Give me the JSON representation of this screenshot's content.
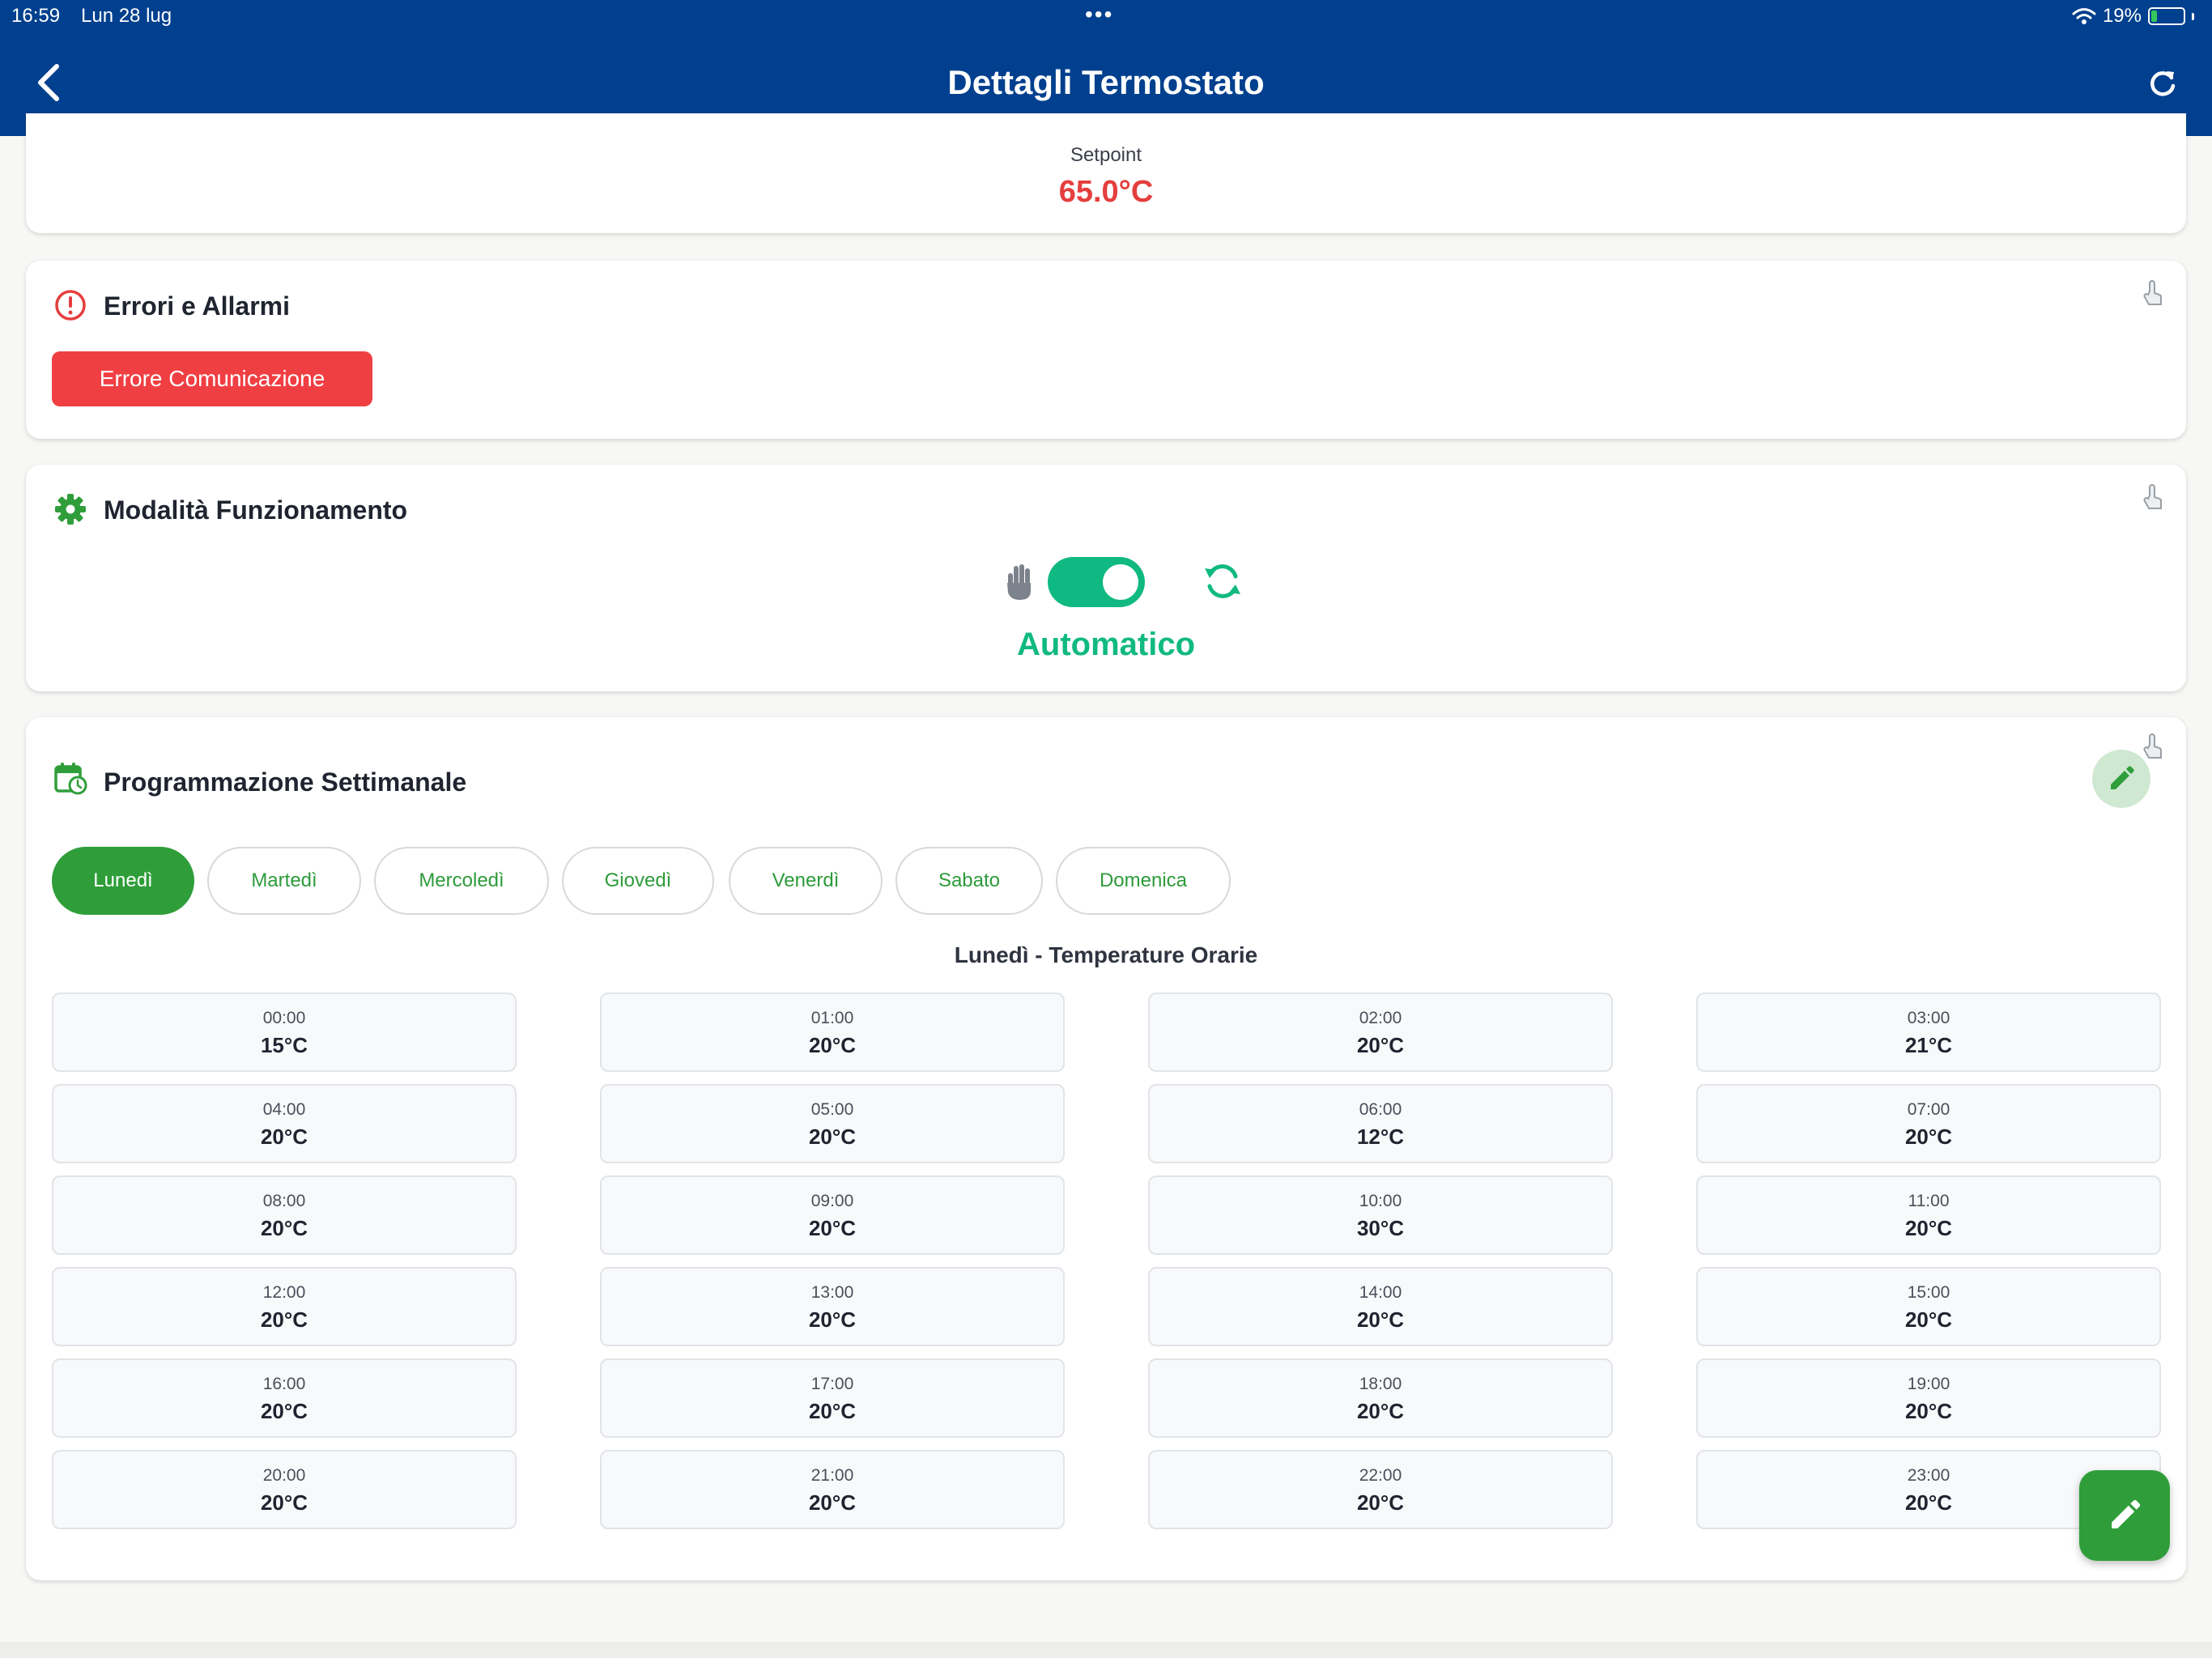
{
  "status_bar": {
    "time": "16:59",
    "date": "Lun 28 lug",
    "dots": "•••",
    "battery_percent": "19%",
    "battery_level": 0.19,
    "icons": [
      "wifi-icon",
      "battery-charging-icon"
    ]
  },
  "header": {
    "title": "Dettagli Termostato",
    "background_color": "#00408e",
    "icons": [
      "back-chevron-icon",
      "refresh-icon"
    ]
  },
  "setpoint": {
    "label": "Setpoint",
    "value": "65.0°C",
    "value_color": "#e53e3e"
  },
  "errors": {
    "title": "Errori e Allarmi",
    "icon": "alert-circle-icon",
    "chips": [
      "Errore Comunicazione"
    ],
    "chip_color": "#f03f43"
  },
  "mode": {
    "title": "Modalità Funzionamento",
    "icon": "gear-icon",
    "toggle_on": true,
    "label": "Automatico",
    "accent_color": "#10b981",
    "icons": [
      "hand-icon",
      "sync-icon"
    ]
  },
  "schedule": {
    "title": "Programmazione Settimanale",
    "icon": "calendar-clock-icon",
    "days": [
      "Lunedì",
      "Martedì",
      "Mercoledì",
      "Giovedì",
      "Venerdì",
      "Sabato",
      "Domenica"
    ],
    "active_day": "Lunedì",
    "hours_title": "Lunedì - Temperature Orarie",
    "accent_color": "#2f9e3a",
    "hours": [
      {
        "time": "00:00",
        "temp": "15°C"
      },
      {
        "time": "01:00",
        "temp": "20°C"
      },
      {
        "time": "02:00",
        "temp": "20°C"
      },
      {
        "time": "03:00",
        "temp": "21°C"
      },
      {
        "time": "04:00",
        "temp": "20°C"
      },
      {
        "time": "05:00",
        "temp": "20°C"
      },
      {
        "time": "06:00",
        "temp": "12°C"
      },
      {
        "time": "07:00",
        "temp": "20°C"
      },
      {
        "time": "08:00",
        "temp": "20°C"
      },
      {
        "time": "09:00",
        "temp": "20°C"
      },
      {
        "time": "10:00",
        "temp": "30°C"
      },
      {
        "time": "11:00",
        "temp": "20°C"
      },
      {
        "time": "12:00",
        "temp": "20°C"
      },
      {
        "time": "13:00",
        "temp": "20°C"
      },
      {
        "time": "14:00",
        "temp": "20°C"
      },
      {
        "time": "15:00",
        "temp": "20°C"
      },
      {
        "time": "16:00",
        "temp": "20°C"
      },
      {
        "time": "17:00",
        "temp": "20°C"
      },
      {
        "time": "18:00",
        "temp": "20°C"
      },
      {
        "time": "19:00",
        "temp": "20°C"
      },
      {
        "time": "20:00",
        "temp": "20°C"
      },
      {
        "time": "21:00",
        "temp": "20°C"
      },
      {
        "time": "22:00",
        "temp": "20°C"
      },
      {
        "time": "23:00",
        "temp": "20°C"
      }
    ]
  }
}
